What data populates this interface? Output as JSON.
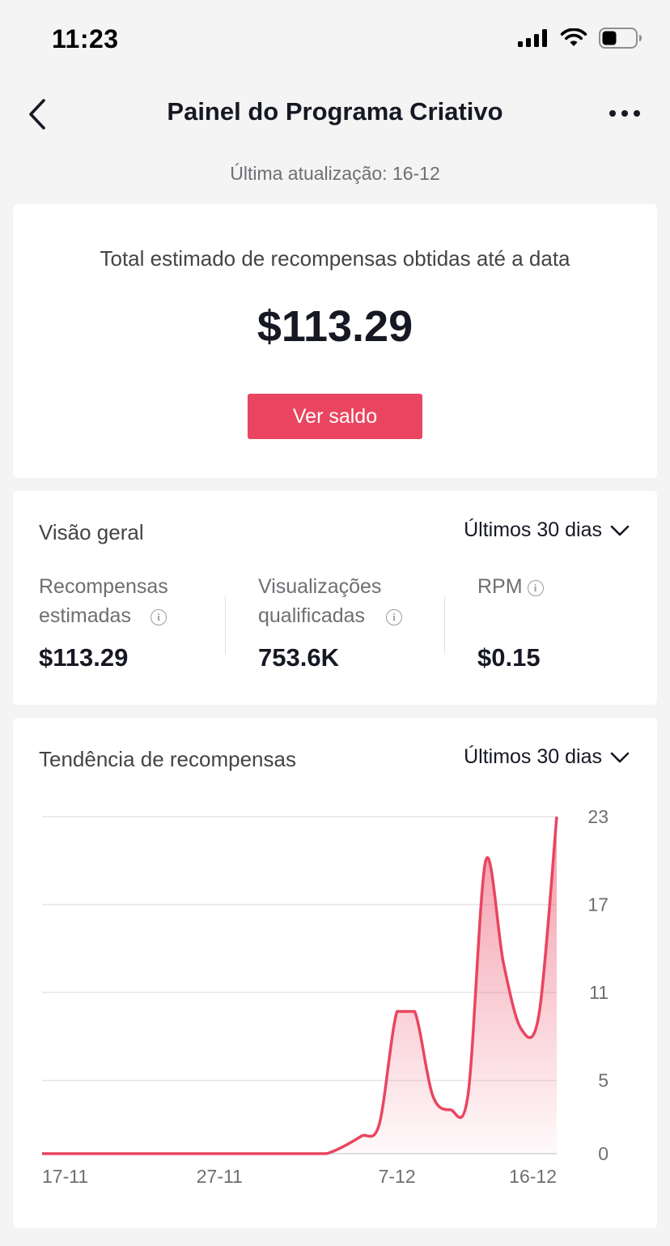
{
  "status": {
    "time": "11:23",
    "icons": [
      "signal-icon",
      "wifi-icon",
      "battery-icon"
    ]
  },
  "nav": {
    "title": "Painel do Programa Criativo",
    "back_icon": "chevron-left-icon",
    "more_icon": "more-icon"
  },
  "updated": "Última atualização: 16-12",
  "summary": {
    "label": "Total estimado de recompensas obtidas até a data",
    "amount": "$113.29",
    "button": "Ver saldo"
  },
  "overview": {
    "title": "Visão geral",
    "range": "Últimos 30 dias",
    "metrics": [
      {
        "label": "Recompensas estimadas",
        "value": "$113.29"
      },
      {
        "label": "Visualizações qualificadas",
        "value": "753.6K"
      },
      {
        "label": "RPM",
        "value": "$0.15"
      }
    ]
  },
  "trend": {
    "title": "Tendência de recompensas",
    "range": "Últimos 30 dias"
  },
  "colors": {
    "accent": "#e94560",
    "background": "#f4f4f4",
    "card": "#ffffff",
    "text": "#161823"
  },
  "chart_data": {
    "type": "area",
    "x": [
      "17-11",
      "18-11",
      "19-11",
      "20-11",
      "21-11",
      "22-11",
      "23-11",
      "24-11",
      "25-11",
      "26-11",
      "27-11",
      "28-11",
      "29-11",
      "30-11",
      "1-12",
      "2-12",
      "3-12",
      "4-12",
      "5-12",
      "6-12",
      "7-12",
      "8-12",
      "9-12",
      "10-12",
      "11-12",
      "12-12",
      "13-12",
      "14-12",
      "15-12",
      "16-12"
    ],
    "values": [
      0,
      0,
      0,
      0,
      0,
      0,
      0,
      0,
      0,
      0,
      0,
      0,
      0,
      0,
      0,
      0,
      0,
      0.5,
      1.2,
      2,
      9.7,
      9.7,
      4,
      3,
      4,
      20,
      13,
      8.5,
      9.5,
      23
    ],
    "x_tick_labels": [
      "17-11",
      "27-11",
      "7-12",
      "16-12"
    ],
    "y_ticks": [
      0,
      5,
      11,
      17,
      23
    ],
    "ylim": [
      0,
      23
    ],
    "y_axis_position": "right",
    "grid": true,
    "color": "#e94560"
  }
}
